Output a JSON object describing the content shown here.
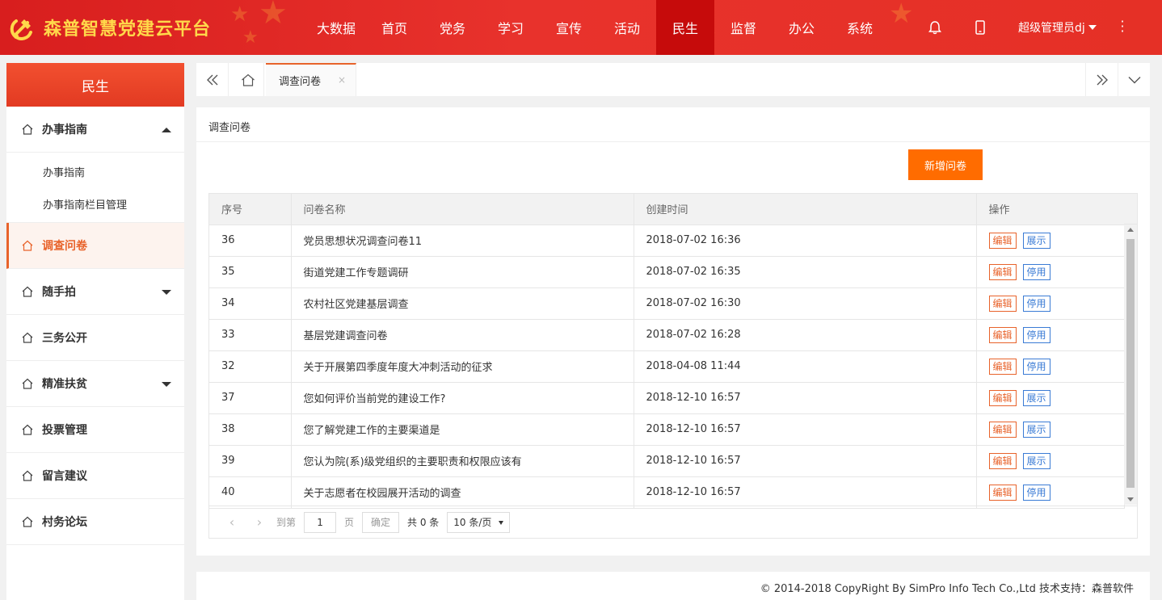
{
  "header": {
    "app_title": "森普智慧党建云平台",
    "nav": [
      "大数据",
      "首页",
      "党务",
      "学习",
      "宣传",
      "活动",
      "民生",
      "监督",
      "办公",
      "系统"
    ],
    "active_nav": "民生",
    "user_name": "超级管理员dj",
    "icons": [
      "bell-icon",
      "mobile-icon",
      "more-icon"
    ]
  },
  "sidebar": {
    "title": "民生",
    "groups": [
      {
        "label": "办事指南",
        "expanded": true,
        "children": [
          "办事指南",
          "办事指南栏目管理"
        ]
      },
      {
        "label": "调查问卷",
        "active": true
      },
      {
        "label": "随手拍",
        "has_children": true
      },
      {
        "label": "三务公开"
      },
      {
        "label": "精准扶贫",
        "has_children": true
      },
      {
        "label": "投票管理"
      },
      {
        "label": "留言建议"
      },
      {
        "label": "村务论坛"
      }
    ]
  },
  "tabs": {
    "current": "调查问卷",
    "close": "×"
  },
  "main": {
    "title": "调查问卷",
    "add_button": "新增问卷",
    "columns": [
      "序号",
      "问卷名称",
      "创建时间",
      "操作"
    ],
    "rows": [
      {
        "id": "36",
        "name": "党员思想状况调查问卷11",
        "time": "2018-07-02 16:36",
        "ops": [
          "编辑",
          "展示"
        ]
      },
      {
        "id": "35",
        "name": "街道党建工作专题调研",
        "time": "2018-07-02 16:35",
        "ops": [
          "编辑",
          "停用"
        ]
      },
      {
        "id": "34",
        "name": "农村社区党建基层调查",
        "time": "2018-07-02 16:30",
        "ops": [
          "编辑",
          "停用"
        ]
      },
      {
        "id": "33",
        "name": "基层党建调查问卷",
        "time": "2018-07-02 16:28",
        "ops": [
          "编辑",
          "停用"
        ]
      },
      {
        "id": "32",
        "name": "关于开展第四季度年度大冲刺活动的征求",
        "time": "2018-04-08 11:44",
        "ops": [
          "编辑",
          "停用"
        ]
      },
      {
        "id": "37",
        "name": "您如何评价当前党的建设工作?",
        "time": "2018-12-10 16:57",
        "ops": [
          "编辑",
          "展示"
        ]
      },
      {
        "id": "38",
        "name": "您了解党建工作的主要渠道是",
        "time": "2018-12-10 16:57",
        "ops": [
          "编辑",
          "展示"
        ]
      },
      {
        "id": "39",
        "name": "您认为院(系)级党组织的主要职责和权限应该有",
        "time": "2018-12-10 16:57",
        "ops": [
          "编辑",
          "展示"
        ]
      },
      {
        "id": "40",
        "name": "关于志愿者在校园展开活动的调查",
        "time": "2018-12-10 16:57",
        "ops": [
          "编辑",
          "停用"
        ]
      }
    ],
    "pager": {
      "goto_label": "到第",
      "page_value": "1",
      "page_unit": "页",
      "confirm": "确定",
      "total": "共 0 条",
      "page_size": "10 条/页"
    }
  },
  "footer": {
    "copyright": "© 2014-2018 CopyRight By SimPro Info Tech Co.,Ltd 技术支持：森普软件"
  },
  "colors": {
    "header_red": "#e53026",
    "nav_active": "#c60b0b",
    "accent_orange": "#ff6c00",
    "edit_orange": "#e8632b",
    "link_blue": "#3a7bd5",
    "logo_gold": "#ffd84a"
  }
}
